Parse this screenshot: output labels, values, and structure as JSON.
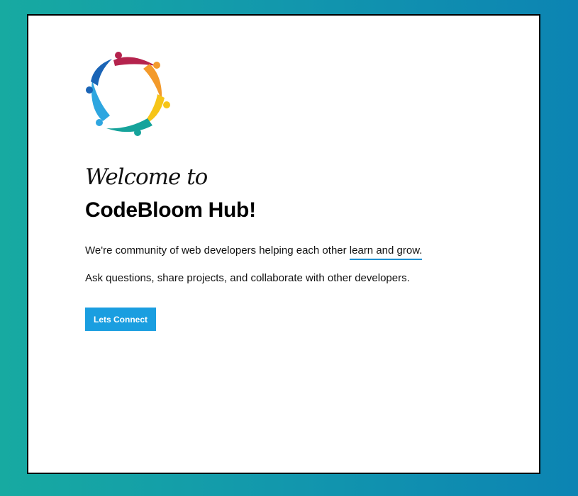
{
  "hero": {
    "welcome_text": "Welcome to",
    "title": "CodeBloom Hub!",
    "paragraph1_prefix": "We're community of web developers helping each other ",
    "paragraph1_highlight": "learn and grow.",
    "paragraph2": "Ask questions, share projects, and collaborate with other developers.",
    "cta_label": "Lets Connect"
  },
  "colors": {
    "background_gradient_start": "#17aaa1",
    "background_gradient_end": "#0c84b3",
    "card_background": "#ffffff",
    "button_background": "#1a9ee0",
    "underline_accent": "#1e8fd0"
  },
  "logo": {
    "icon": "community-circle-logo",
    "palette": [
      "#b5234d",
      "#f39a2b",
      "#f6c518",
      "#16a39b",
      "#2ea6e0",
      "#1a64b6"
    ]
  }
}
